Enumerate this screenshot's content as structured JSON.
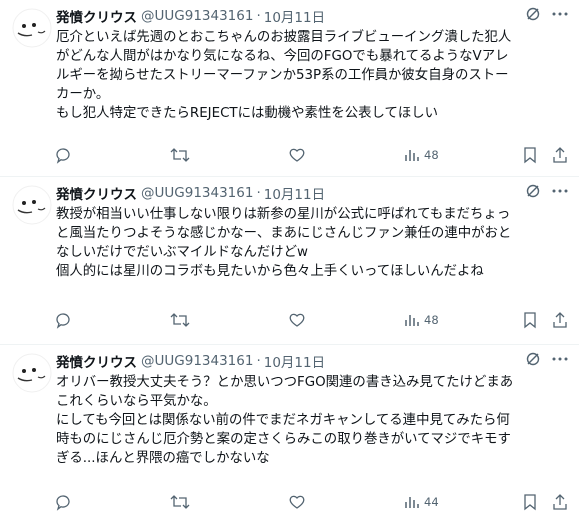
{
  "tweets": [
    {
      "name": "発憤クリウス",
      "handle": "@UUG91343161",
      "separator": "·",
      "time": "10月11日",
      "lines": [
        "厄介といえば先週のとおこちゃんのお披露目ライブビューイング潰した犯人",
        "がどんな人間がはかなり気になるね、今回のFGOでも暴れてるようなVアレ",
        "ルギーを拗らせたストリーマーファンか53P系の工作員か彼女自身のストー",
        "カーか。",
        "もし犯人特定できたらREJECTには動機や素性を公表してほしい"
      ],
      "views": "48"
    },
    {
      "name": "発憤クリウス",
      "handle": "@UUG91343161",
      "separator": "·",
      "time": "10月11日",
      "lines": [
        "教授が相当いい仕事しない限りは新参の星川が公式に呼ばれてもまだちょっ",
        "と風当たりつよそうな感じかなー、まあにじさんじファン兼任の連中がおと",
        "なしいだけでだいぶマイルドなんだけどw",
        "個人的には星川のコラボも見たいから色々上手くいってほしいんだよね"
      ],
      "views": "48"
    },
    {
      "name": "発憤クリウス",
      "handle": "@UUG91343161",
      "separator": "·",
      "time": "10月11日",
      "lines": [
        "オリバー教授大丈夫そう？とか思いつつFGO関連の書き込み見てたけどまあ",
        "これくらいなら平気かな。",
        "にしても今回とは関係ない前の件でまだネガキャンしてる連中見てみたら何",
        "時ものにじさんじ厄介勢と案の定さくらみこの取り巻きがいてマジでキモす",
        "ぎる...ほんと界隈の癌でしかないな"
      ],
      "views": "44"
    }
  ],
  "icons": {
    "grok": "grok-icon",
    "more": "more-icon",
    "reply": "reply-icon",
    "retweet": "retweet-icon",
    "like": "like-icon",
    "views": "views-icon",
    "bookmark": "bookmark-icon",
    "share": "share-icon"
  },
  "colors": {
    "text": "#0f1419",
    "secondary": "#536471",
    "divider": "#eff3f4",
    "background": "#ffffff"
  }
}
